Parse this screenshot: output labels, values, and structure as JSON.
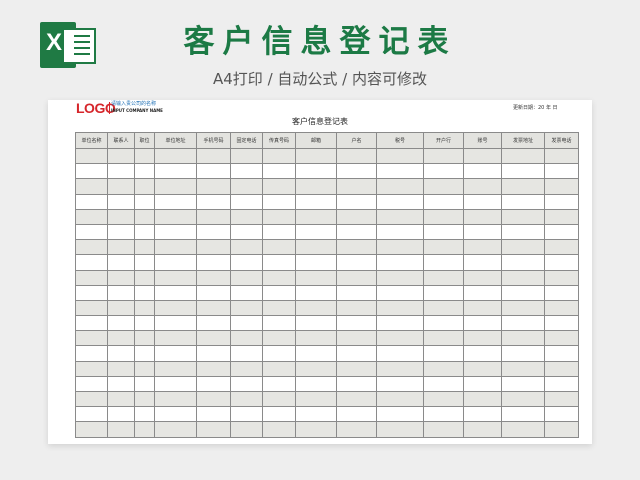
{
  "header": {
    "icon_name": "excel-icon",
    "icon_letter": "X",
    "title": "客户信息登记表",
    "subtitle": "A4打印 / 自动公式 / 内容可修改",
    "title_color": "#1c7a45"
  },
  "sheet": {
    "logo": "LOGO",
    "company_name_placeholder": "请输入贵公司的名称",
    "company_name_en": "INPUT COMPANY NAME",
    "update_date": "更新日期：20   年     日",
    "form_title": "客户信息登记表",
    "columns": [
      "单位名称",
      "联系人",
      "职位",
      "单位地址",
      "手机号码",
      "固定电话",
      "传真号码",
      "邮箱",
      "户名",
      "税号",
      "开户行",
      "账号",
      "发票地址",
      "发票电话"
    ],
    "row_count": 19,
    "logo_color": "#d6262b",
    "shade_color": "#e6e6e2"
  }
}
